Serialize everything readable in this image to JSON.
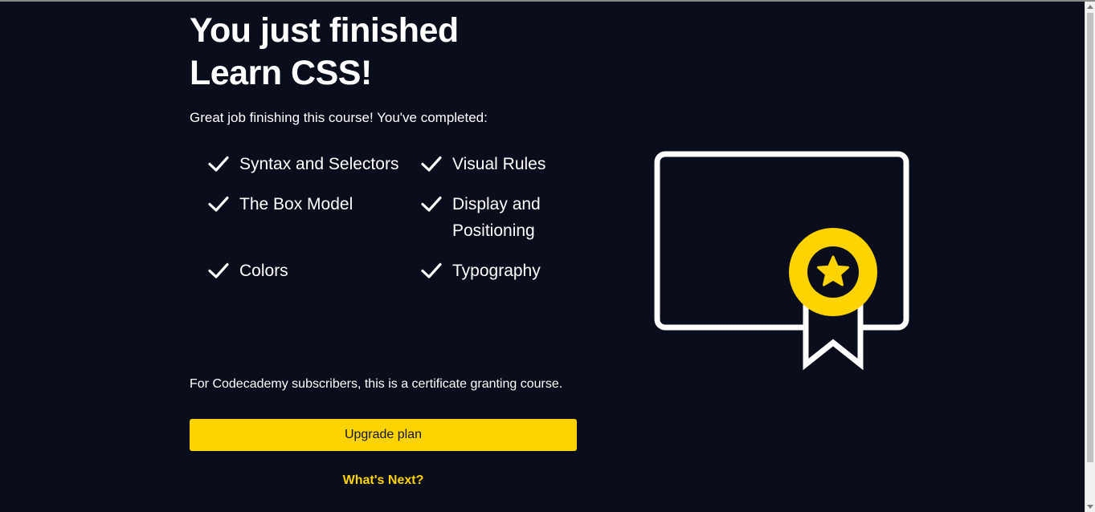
{
  "heading": {
    "line1": "You just finished",
    "line2": "Learn CSS!"
  },
  "intro": "Great job finishing this course! You've completed:",
  "completed_topics": [
    "Syntax and Selectors",
    "Visual Rules",
    "The Box Model",
    "Display and Positioning",
    "Colors",
    "Typography"
  ],
  "subscriber_note": "For Codecademy subscribers, this is a certificate granting course.",
  "upgrade_label": "Upgrade plan",
  "whats_next_label": "What's Next?",
  "icons": {
    "check": "checkmark-icon",
    "certificate": "certificate-icon",
    "badge": "award-ribbon-icon",
    "star": "star-icon"
  },
  "colors": {
    "background": "#0a0d1c",
    "accent": "#ffd300",
    "text": "#ffffff",
    "button_text": "#10162f"
  }
}
